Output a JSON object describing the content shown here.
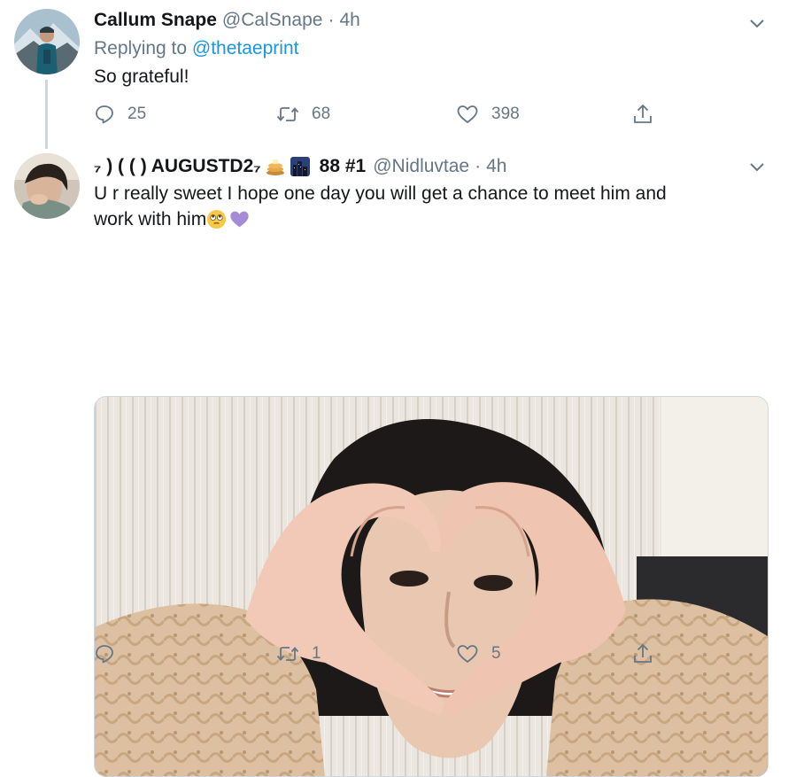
{
  "tweets": [
    {
      "name": "Callum Snape",
      "handle": "@CalSnape",
      "separator": "·",
      "time": "4h",
      "replying_prefix": "Replying to",
      "replying_to": "@thetaeprint",
      "text": "So grateful!",
      "replies": "25",
      "retweets": "68",
      "likes": "398"
    },
    {
      "name_prefix": "₇ ) ( ( ) AUGUSTD2₇",
      "name_suffix": "88 #1",
      "handle": "@Nidluvtae",
      "separator": "·",
      "time": "4h",
      "text_line1": "U r really sweet I hope one day you will get a chance to meet him and",
      "text_line2": "work with him",
      "replies": "",
      "retweets": "1",
      "likes": "5"
    }
  ],
  "icons": {
    "reply": "reply-icon",
    "retweet": "retweet-icon",
    "like": "heart-icon",
    "share": "share-icon",
    "more": "chevron-down-icon"
  },
  "colors": {
    "text": "#14171a",
    "muted": "#657786",
    "link": "#1b95e0",
    "thread_line": "#ccd6dd",
    "purple_heart": "#a58bd6"
  }
}
